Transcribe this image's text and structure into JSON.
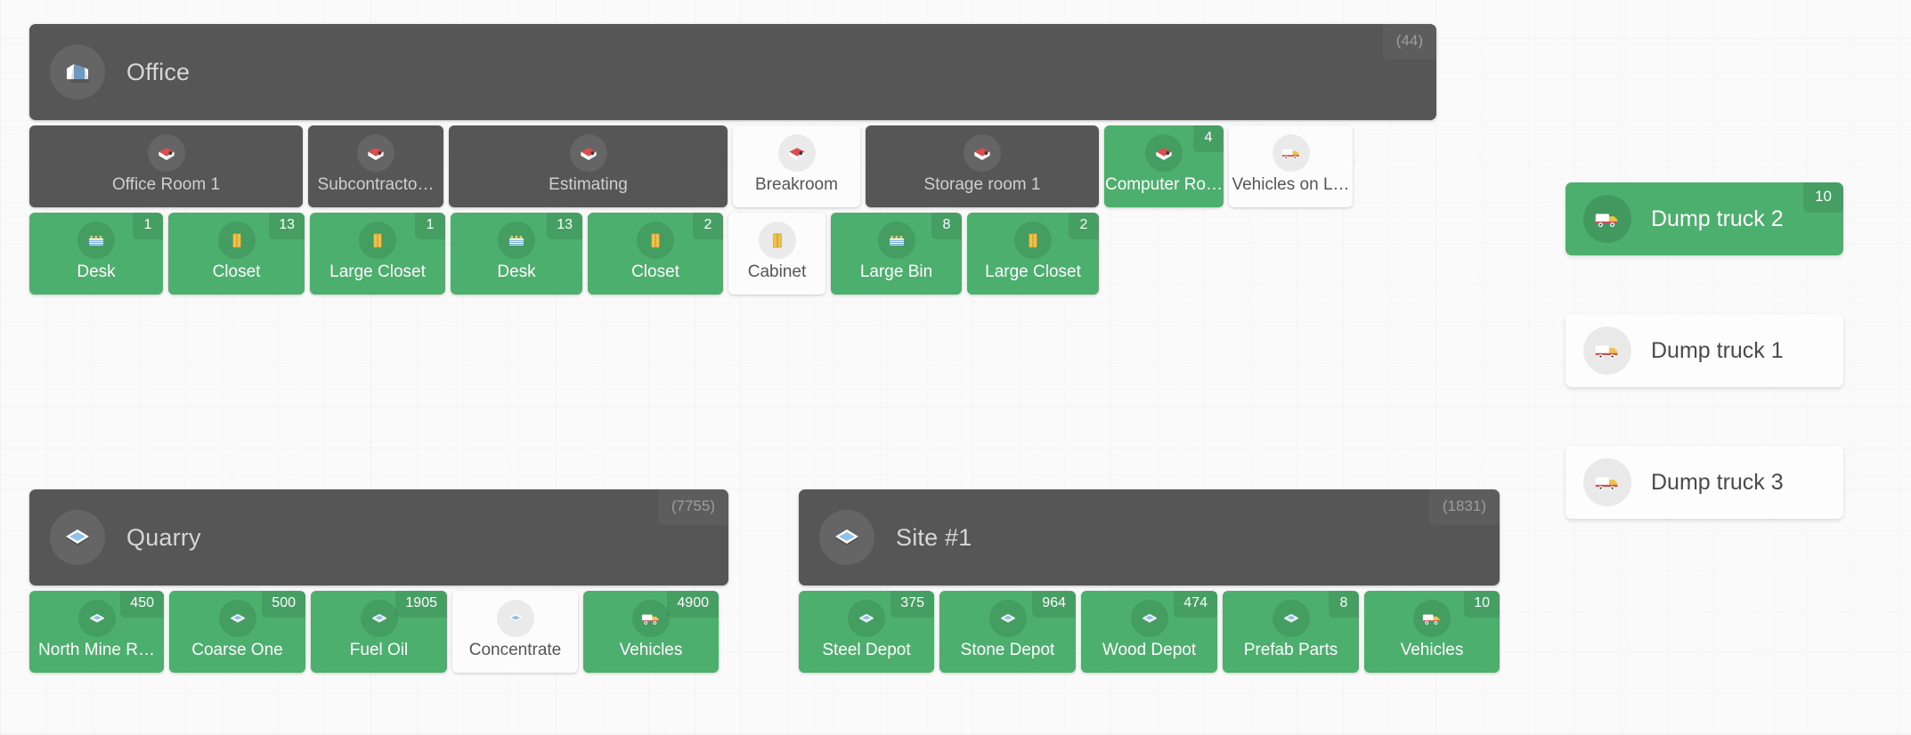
{
  "groups": [
    {
      "id": "office",
      "name": "Office",
      "count": "(44)",
      "icon": "building-icon",
      "rooms": [
        {
          "label": "Office Room 1",
          "badge": null,
          "state": "dark",
          "icon": "room-icon"
        },
        {
          "label": "Subcontracto…",
          "badge": null,
          "state": "dark",
          "icon": "room-icon"
        },
        {
          "label": "Estimating",
          "badge": null,
          "state": "dark",
          "icon": "room-icon"
        },
        {
          "label": "Breakroom",
          "badge": null,
          "state": "white",
          "icon": "room-icon"
        },
        {
          "label": "Storage room 1",
          "badge": null,
          "state": "dark",
          "icon": "room-icon"
        },
        {
          "label": "Computer Ro…",
          "badge": "4",
          "state": "green",
          "icon": "room-icon"
        },
        {
          "label": "Vehicles on L…",
          "badge": null,
          "state": "white",
          "icon": "truck-icon"
        }
      ],
      "items": [
        {
          "label": "Desk",
          "badge": "1",
          "state": "green",
          "icon": "desk-icon"
        },
        {
          "label": "Closet",
          "badge": "13",
          "state": "green",
          "icon": "closet-icon"
        },
        {
          "label": "Large Closet",
          "badge": "1",
          "state": "green",
          "icon": "closet-icon"
        },
        {
          "label": "Desk",
          "badge": "13",
          "state": "green",
          "icon": "desk-icon"
        },
        {
          "label": "Closet",
          "badge": "2",
          "state": "green",
          "icon": "closet-icon"
        },
        {
          "label": "Cabinet",
          "badge": null,
          "state": "white",
          "icon": "closet-icon"
        },
        {
          "label": "Large Bin",
          "badge": "8",
          "state": "green",
          "icon": "desk-icon"
        },
        {
          "label": "Large Closet",
          "badge": "2",
          "state": "green",
          "icon": "closet-icon"
        }
      ]
    },
    {
      "id": "quarry",
      "name": "Quarry",
      "count": "(7755)",
      "icon": "layers-icon",
      "rooms": [],
      "items": [
        {
          "label": "North Mine R…",
          "badge": "450",
          "state": "green",
          "icon": "layers-icon"
        },
        {
          "label": "Coarse One",
          "badge": "500",
          "state": "green",
          "icon": "layers-icon"
        },
        {
          "label": "Fuel Oil",
          "badge": "1905",
          "state": "green",
          "icon": "layers-icon"
        },
        {
          "label": "Concentrate",
          "badge": null,
          "state": "white",
          "icon": "layers-icon"
        },
        {
          "label": "Vehicles",
          "badge": "4900",
          "state": "green",
          "icon": "truck-icon"
        }
      ]
    },
    {
      "id": "site-1",
      "name": "Site #1",
      "count": "(1831)",
      "icon": "layers-icon",
      "rooms": [],
      "items": [
        {
          "label": "Steel Depot",
          "badge": "375",
          "state": "green",
          "icon": "layers-icon"
        },
        {
          "label": "Stone Depot",
          "badge": "964",
          "state": "green",
          "icon": "layers-icon"
        },
        {
          "label": "Wood Depot",
          "badge": "474",
          "state": "green",
          "icon": "layers-icon"
        },
        {
          "label": "Prefab Parts",
          "badge": "8",
          "state": "green",
          "icon": "layers-icon"
        },
        {
          "label": "Vehicles",
          "badge": "10",
          "state": "green",
          "icon": "truck-icon"
        }
      ]
    }
  ],
  "vehicles": [
    {
      "label": "Dump truck 2",
      "badge": "10",
      "state": "green",
      "icon": "truck-icon"
    },
    {
      "label": "Dump truck 1",
      "badge": null,
      "state": "white",
      "icon": "truck-icon"
    },
    {
      "label": "Dump truck 3",
      "badge": null,
      "state": "white",
      "icon": "truck-icon"
    }
  ],
  "colors": {
    "accent_green": "#4caf6d",
    "panel_dark": "#565656",
    "tile_white": "#fcfcfc",
    "background": "#fafafa"
  }
}
